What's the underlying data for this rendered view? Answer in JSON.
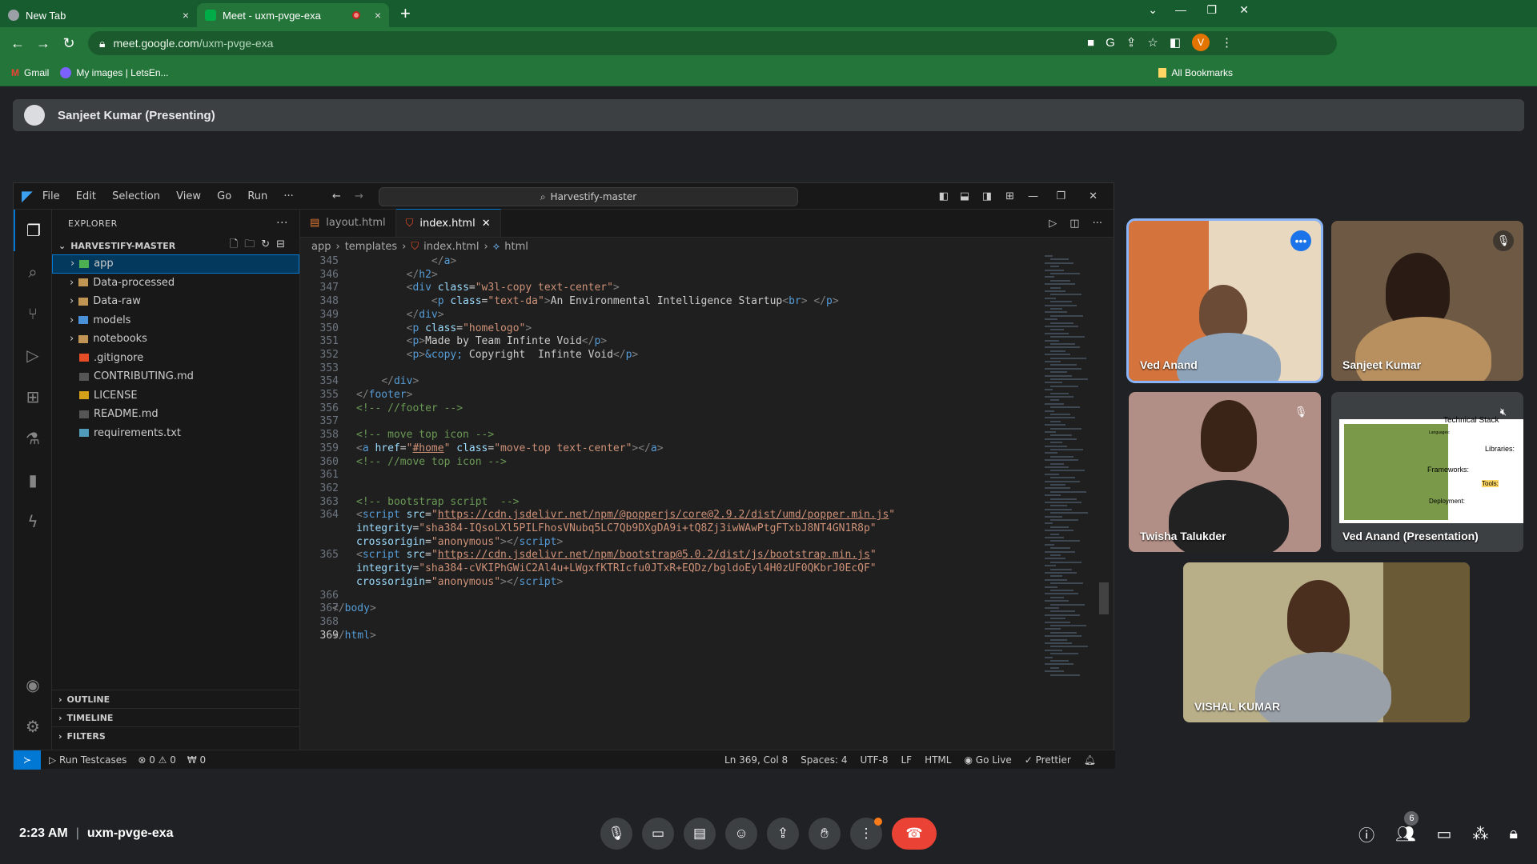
{
  "browser": {
    "tabs": [
      {
        "title": "New Tab",
        "close": "×"
      },
      {
        "title": "Meet - uxm-pvge-exa",
        "close": "×"
      }
    ],
    "new_tab": "+",
    "url_host": "meet.google.com",
    "url_path": "/uxm-pvge-exa",
    "profile_initial": "V",
    "bookmarks": [
      "Gmail",
      "My images | LetsEn..."
    ],
    "all_bookmarks": "All Bookmarks"
  },
  "meet": {
    "presenting_label": "Sanjeet Kumar (Presenting)",
    "time": "2:23 AM",
    "meeting_code": "uxm-pvge-exa",
    "participant_count": "6",
    "participants": [
      {
        "name": "Ved Anand"
      },
      {
        "name": "Sanjeet Kumar"
      },
      {
        "name": "Twisha Talukder"
      },
      {
        "name": "Ved Anand (Presentation)"
      },
      {
        "name": "VISHAL KUMAR"
      }
    ],
    "slide": {
      "title": "Technical Stack",
      "items": [
        "Languages:",
        "Libraries:",
        "Frameworks:",
        "Tools:",
        "Deployment:"
      ]
    }
  },
  "vscode": {
    "menu": [
      "File",
      "Edit",
      "Selection",
      "View",
      "Go",
      "Run",
      "···"
    ],
    "search": "Harvestify-master",
    "explorer_title": "EXPLORER",
    "explorer_more": "···",
    "root": "HARVESTIFY-MASTER",
    "tree": [
      {
        "name": "app",
        "kind": "folder"
      },
      {
        "name": "Data-processed",
        "kind": "folder"
      },
      {
        "name": "Data-raw",
        "kind": "folder"
      },
      {
        "name": "models",
        "kind": "folder"
      },
      {
        "name": "notebooks",
        "kind": "folder"
      },
      {
        "name": ".gitignore",
        "kind": "file"
      },
      {
        "name": "CONTRIBUTING.md",
        "kind": "file"
      },
      {
        "name": "LICENSE",
        "kind": "file"
      },
      {
        "name": "README.md",
        "kind": "file"
      },
      {
        "name": "requirements.txt",
        "kind": "file"
      }
    ],
    "outline": "OUTLINE",
    "timeline": "TIMELINE",
    "filters": "FILTERS",
    "tabs": [
      "layout.html",
      "index.html"
    ],
    "breadcrumb": [
      "app",
      "templates",
      "index.html",
      "html"
    ],
    "status": {
      "run": "Run Testcases",
      "problems": "⊗ 0 ⚠ 0",
      "ports": "₩ 0",
      "position": "Ln 369, Col 8",
      "spaces": "Spaces: 4",
      "encoding": "UTF-8",
      "eol": "LF",
      "language": "HTML",
      "golive": "Go Live",
      "prettier": "✓ Prettier"
    }
  }
}
